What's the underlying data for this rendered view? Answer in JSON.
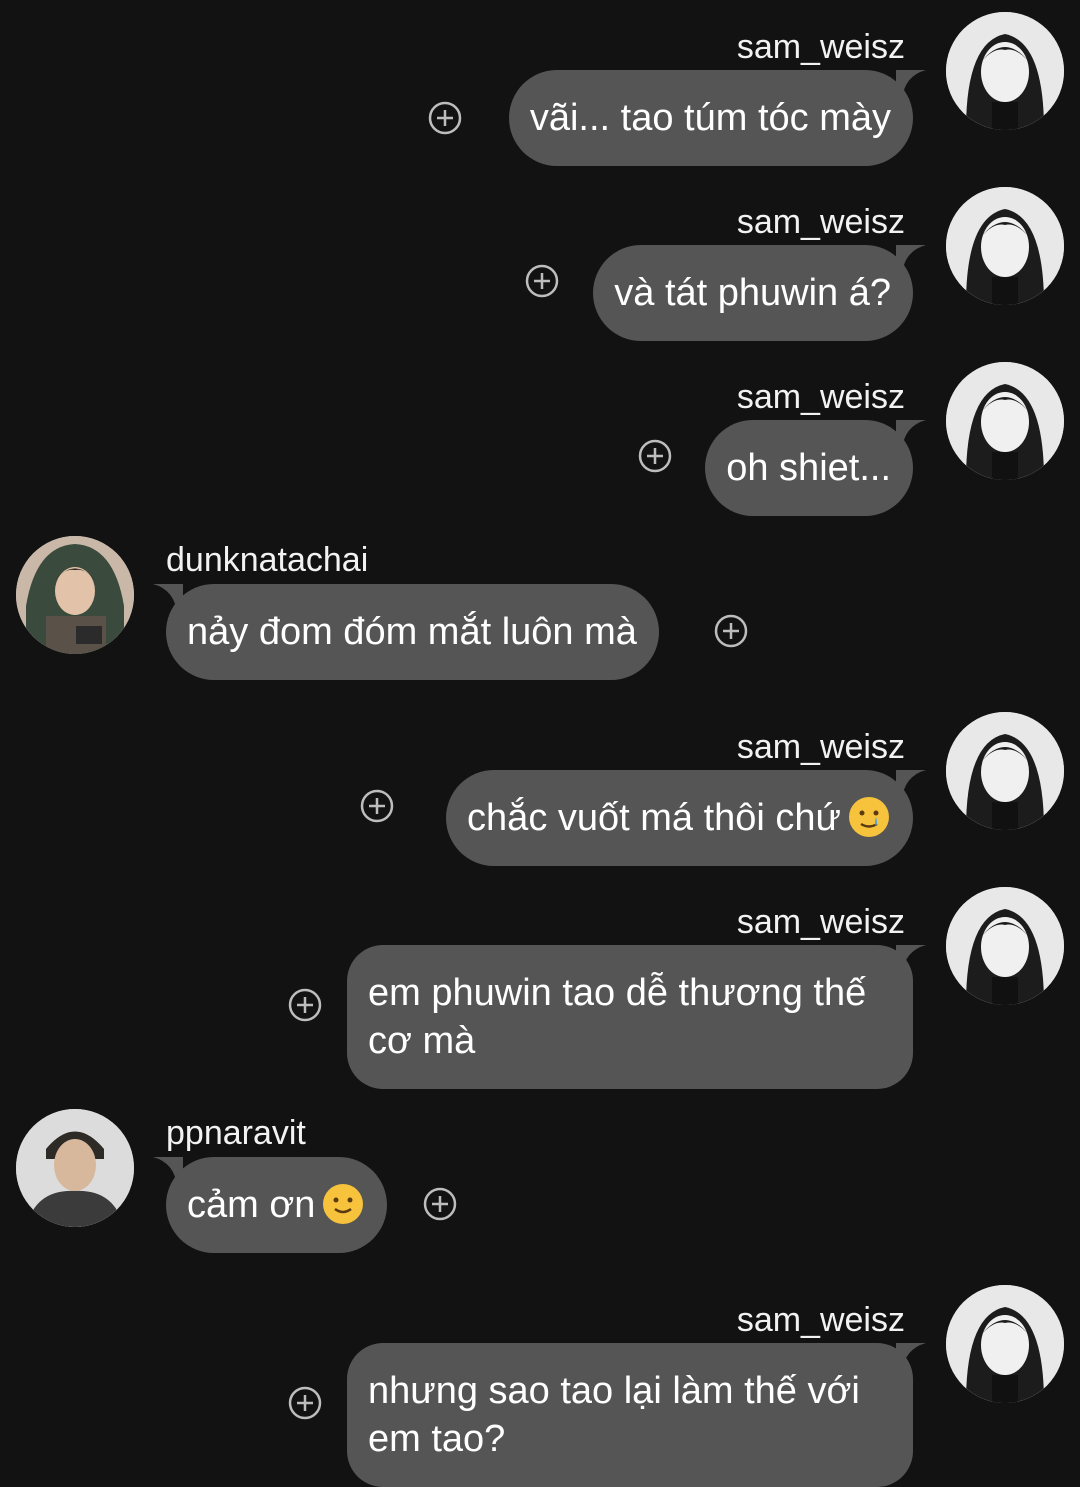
{
  "messages": [
    {
      "direction": "out",
      "username": "sam_weisz",
      "text": "vãi... tao túm tóc mày"
    },
    {
      "direction": "out",
      "username": "sam_weisz",
      "text": "và tát phuwin á?"
    },
    {
      "direction": "out",
      "username": "sam_weisz",
      "text": "oh shiet..."
    },
    {
      "direction": "in",
      "username": "dunknatachai",
      "text": "nảy đom đóm mắt luôn mà"
    },
    {
      "direction": "out",
      "username": "sam_weisz",
      "text": "chắc vuốt má thôi chứ",
      "emoji": "smiling-face-with-tear"
    },
    {
      "direction": "out",
      "username": "sam_weisz",
      "text": "em phuwin tao dễ thương thế cơ mà"
    },
    {
      "direction": "in",
      "username": "ppnaravit",
      "text": "cảm ơn",
      "emoji": "slightly-smiling-face"
    },
    {
      "direction": "out",
      "username": "sam_weisz",
      "text": "nhưng sao tao lại làm thế với em tao?"
    }
  ],
  "colors": {
    "background": "#121212",
    "bubble": "#555555",
    "text": "#ffffff",
    "icon": "#bdbdbd"
  },
  "icons": {
    "add": "add-reaction-icon"
  }
}
